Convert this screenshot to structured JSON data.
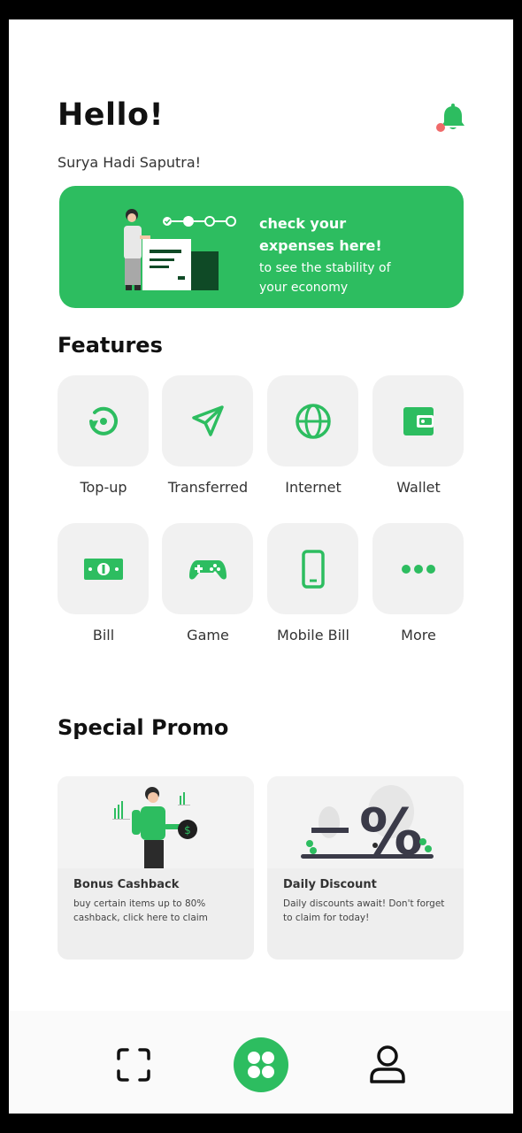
{
  "header": {
    "greeting": "Hello!",
    "username": "Surya Hadi Saputra!"
  },
  "banner": {
    "title": "check your expenses here!",
    "subtitle": "to see the stability of your economy"
  },
  "features": {
    "title": "Features",
    "items": [
      {
        "label": "Top-up",
        "icon": "topup-icon"
      },
      {
        "label": "Transferred",
        "icon": "send-icon"
      },
      {
        "label": "Internet",
        "icon": "globe-icon"
      },
      {
        "label": "Wallet",
        "icon": "wallet-icon"
      },
      {
        "label": "Bill",
        "icon": "banknote-icon"
      },
      {
        "label": "Game",
        "icon": "gamepad-icon"
      },
      {
        "label": "Mobile Bill",
        "icon": "phone-icon"
      },
      {
        "label": "More",
        "icon": "more-dots-icon"
      }
    ]
  },
  "promo": {
    "title": "Special Promo",
    "cards": [
      {
        "title": "Bonus Cashback",
        "description": "buy certain items up to 80% cashback, click here to claim"
      },
      {
        "title": "Daily Discount",
        "description": "Daily discounts await! Don't forget to claim for today!"
      }
    ]
  },
  "colors": {
    "accent": "#2dbd60",
    "tile_bg": "#f1f1f1",
    "notification_dot": "#f06a6a"
  }
}
